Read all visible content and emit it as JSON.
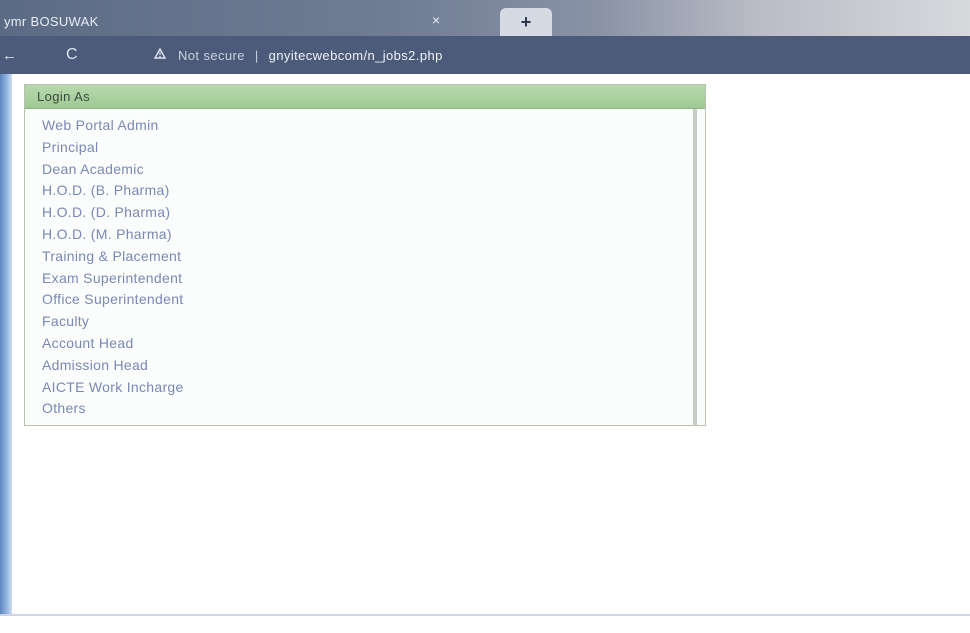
{
  "browser": {
    "tab_title": "ymr BOSUWAK",
    "tab_close_glyph": "×",
    "new_tab_glyph": "+",
    "back_glyph": "←",
    "reload_glyph": "C",
    "security_icon": "lock-icon",
    "security_label": "Not secure",
    "separator": "|",
    "url": "gnyitecwebcom/n_jobs2.php"
  },
  "login_panel": {
    "header": "Login As",
    "options": [
      "Web Portal Admin",
      "Principal",
      "Dean Academic",
      "H.O.D. (B. Pharma)",
      "H.O.D. (D. Pharma)",
      "H.O.D. (M. Pharma)",
      "Training & Placement",
      "Exam Superintendent",
      "Office Superintendent",
      "Faculty",
      "Account Head",
      "Admission Head",
      "AICTE Work Incharge",
      "Others"
    ]
  },
  "colors": {
    "chrome_dark": "#4d5b7a",
    "panel_header": "#a8cf9c",
    "option_text": "#7a88b4"
  }
}
